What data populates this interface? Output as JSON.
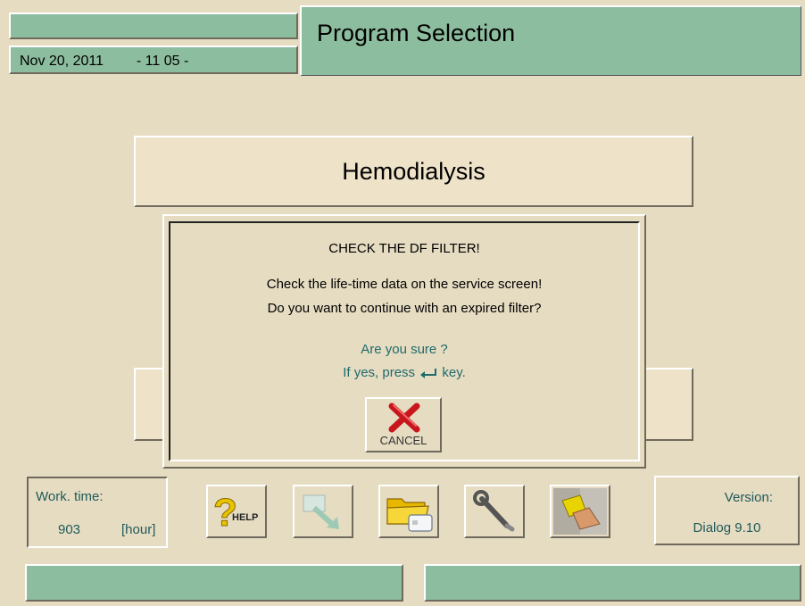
{
  "header": {
    "title": "Program Selection",
    "date": "Nov 20, 2011",
    "time": "- 11 05 -"
  },
  "program": {
    "selected_label": "Hemodialysis"
  },
  "dialog": {
    "heading": "CHECK THE DF FILTER!",
    "line1": "Check the life-time data on the service screen!",
    "line2": "Do you want to continue with an expired filter?",
    "confirm_question": "Are you sure ?",
    "confirm_instruction_prefix": "If yes, press",
    "confirm_instruction_suffix": "key.",
    "cancel_label": "CANCEL"
  },
  "work_time": {
    "label": "Work. time:",
    "value": "903",
    "unit": "[hour]"
  },
  "version": {
    "label": "Version:",
    "value": "Dialog 9.10"
  },
  "toolbar": {
    "help_label": "HELP",
    "icons": [
      "help-icon",
      "import-data-icon",
      "folder-card-icon",
      "wrench-icon",
      "cleaning-icon"
    ]
  },
  "colors": {
    "background": "#e6dcc2",
    "panel_green": "#8dbd9f",
    "info_text": "#1f6a6a",
    "cancel_red": "#c8161d"
  }
}
